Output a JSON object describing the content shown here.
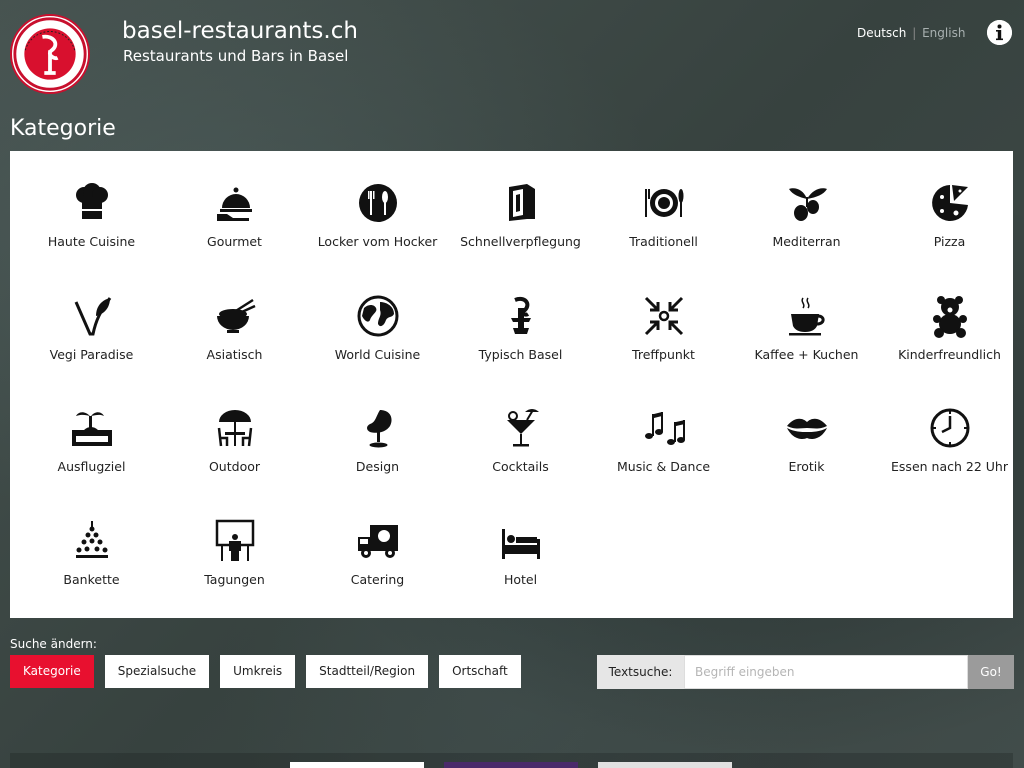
{
  "header": {
    "logo_icon": "wirteverband-basel-stadt-seal",
    "title": "basel-restaurants.ch",
    "subtitle": "Restaurants und Bars in Basel",
    "lang_active": "Deutsch",
    "lang_separator": "|",
    "lang_other": "English",
    "info_icon": "info-icon"
  },
  "page": {
    "title": "Kategorie"
  },
  "categories": [
    {
      "label": "Haute Cuisine",
      "icon": "chef-hat-icon"
    },
    {
      "label": "Gourmet",
      "icon": "cloche-icon"
    },
    {
      "label": "Locker vom Hocker",
      "icon": "plate-cutlery-icon"
    },
    {
      "label": "Schnellverpflegung",
      "icon": "takeaway-bag-icon"
    },
    {
      "label": "Traditionell",
      "icon": "traditional-plate-icon"
    },
    {
      "label": "Mediterran",
      "icon": "olive-icon"
    },
    {
      "label": "Pizza",
      "icon": "pizza-icon"
    },
    {
      "label": "Vegi Paradise",
      "icon": "leaf-icon"
    },
    {
      "label": "Asiatisch",
      "icon": "rice-bowl-icon"
    },
    {
      "label": "World Cuisine",
      "icon": "globe-icon"
    },
    {
      "label": "Typisch Basel",
      "icon": "baselstab-icon"
    },
    {
      "label": "Treffpunkt",
      "icon": "meeting-point-icon"
    },
    {
      "label": "Kaffee + Kuchen",
      "icon": "coffee-cup-icon"
    },
    {
      "label": "Kinderfreundlich",
      "icon": "teddy-bear-icon"
    },
    {
      "label": "Ausflugziel",
      "icon": "island-icon"
    },
    {
      "label": "Outdoor",
      "icon": "parasol-table-icon"
    },
    {
      "label": "Design",
      "icon": "egg-chair-icon"
    },
    {
      "label": "Cocktails",
      "icon": "cocktail-icon"
    },
    {
      "label": "Music & Dance",
      "icon": "music-notes-icon"
    },
    {
      "label": "Erotik",
      "icon": "lips-icon"
    },
    {
      "label": "Essen nach 22 Uhr",
      "icon": "clock-icon"
    },
    {
      "label": "Bankette",
      "icon": "banquet-icon"
    },
    {
      "label": "Tagungen",
      "icon": "presentation-icon"
    },
    {
      "label": "Catering",
      "icon": "delivery-truck-icon"
    },
    {
      "label": "Hotel",
      "icon": "bed-icon"
    }
  ],
  "search": {
    "label": "Suche ändern:",
    "tabs": [
      {
        "label": "Kategorie",
        "active": true
      },
      {
        "label": "Spezialsuche",
        "active": false
      },
      {
        "label": "Umkreis",
        "active": false
      },
      {
        "label": "Stadtteil/Region",
        "active": false
      },
      {
        "label": "Ortschaft",
        "active": false
      }
    ],
    "text_label": "Textsuche:",
    "text_placeholder": "Begriff eingeben",
    "go_label": "Go!"
  },
  "colors": {
    "accent": "#e8102f",
    "panel": "#ffffff",
    "icon": "#111111"
  }
}
